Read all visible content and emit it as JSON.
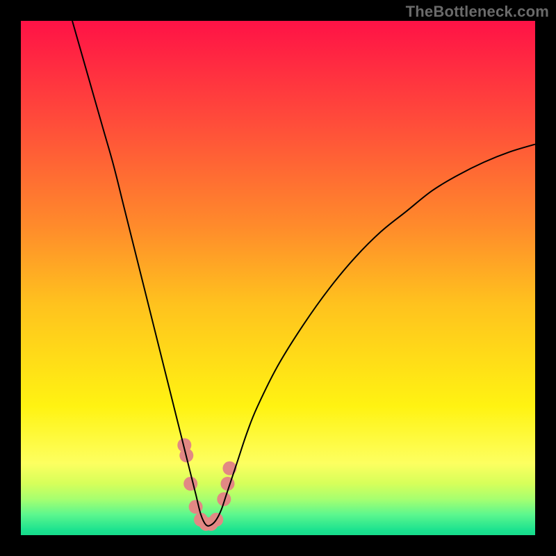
{
  "watermark": "TheBottleneck.com",
  "chart_data": {
    "type": "line",
    "title": "",
    "xlabel": "",
    "ylabel": "",
    "xlim": [
      0,
      100
    ],
    "ylim": [
      0,
      100
    ],
    "grid": false,
    "legend": false,
    "background": {
      "type": "vertical-gradient",
      "stops": [
        {
          "pos": 0.0,
          "color": "#ff1246"
        },
        {
          "pos": 0.2,
          "color": "#ff4d3a"
        },
        {
          "pos": 0.4,
          "color": "#ff8b2b"
        },
        {
          "pos": 0.55,
          "color": "#ffc21e"
        },
        {
          "pos": 0.75,
          "color": "#fff312"
        },
        {
          "pos": 0.86,
          "color": "#fdff60"
        },
        {
          "pos": 0.9,
          "color": "#d6ff5a"
        },
        {
          "pos": 0.93,
          "color": "#a6ff70"
        },
        {
          "pos": 0.96,
          "color": "#5cf78e"
        },
        {
          "pos": 0.99,
          "color": "#1ce28f"
        },
        {
          "pos": 1.0,
          "color": "#17db8b"
        }
      ]
    },
    "series": [
      {
        "name": "bottleneck-curve",
        "color": "#000000",
        "width": 2,
        "x": [
          10,
          12,
          14,
          16,
          18,
          20,
          22,
          24,
          26,
          28,
          30,
          32,
          33,
          34,
          35,
          36,
          37,
          38,
          39,
          40,
          42,
          44,
          46,
          50,
          55,
          60,
          65,
          70,
          75,
          80,
          85,
          90,
          95,
          100
        ],
        "y": [
          100,
          93,
          86,
          79,
          72,
          64,
          56,
          48,
          40,
          32,
          24,
          16,
          12,
          8,
          4,
          2,
          2,
          3,
          5,
          8,
          14,
          20,
          25,
          33,
          41,
          48,
          54,
          59,
          63,
          67,
          70,
          72.5,
          74.5,
          76
        ]
      },
      {
        "name": "salmon-marker-band",
        "type": "scatter",
        "color": "#e28884",
        "x": [
          31.8,
          32.2,
          33.0,
          34.0,
          35.0,
          36.0,
          37.0,
          38.0,
          39.5,
          40.2,
          40.6
        ],
        "y": [
          17.5,
          15.5,
          10.0,
          5.5,
          3.0,
          2.2,
          2.2,
          3.0,
          7.0,
          10.0,
          13.0
        ],
        "marker_size": 20
      }
    ],
    "curve_minimum": {
      "x": 36.5,
      "y": 2
    }
  }
}
